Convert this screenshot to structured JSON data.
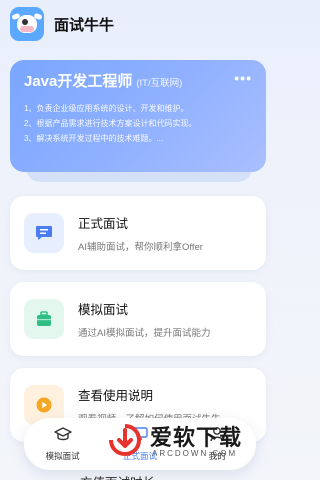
{
  "app": {
    "title": "面试牛牛",
    "logo_icon": "cow-logo-icon"
  },
  "hero": {
    "title": "Java开发工程师",
    "subtitle": "(IT/互联网)",
    "more": "•••",
    "lines": [
      "1、负责企业级应用系统的设计、开发和维护。",
      "2、根据产品需求进行技术方案设计和代码实现。",
      "3、解决系统开发过程中的技术难题。..."
    ]
  },
  "cards": [
    {
      "title": "正式面试",
      "desc": "AI辅助面试，帮你顺利拿Offer",
      "icon": "chat-icon",
      "color": "#4a7df0"
    },
    {
      "title": "模拟面试",
      "desc": "通过AI模拟面试，提升面试能力",
      "icon": "briefcase-icon",
      "color": "#2fbf85"
    },
    {
      "title": "查看使用说明",
      "desc": "观看视频，了解如何使用面试牛牛",
      "icon": "play-icon",
      "color": "#f5a623"
    }
  ],
  "partial_card": {
    "title": "充值面试时长"
  },
  "nav": [
    {
      "label": "模拟面试",
      "icon": "graduation-cap-icon"
    },
    {
      "label": "正式面试",
      "icon": "monitor-icon"
    },
    {
      "label": "我的",
      "icon": "user-icon"
    }
  ],
  "watermark": {
    "text": "爱软下载",
    "sub": "ARCDOWN.COM"
  },
  "colors": {
    "accent": "#4a7df0",
    "hero_start": "#7aa6ff",
    "hero_end": "#a9bfff"
  }
}
